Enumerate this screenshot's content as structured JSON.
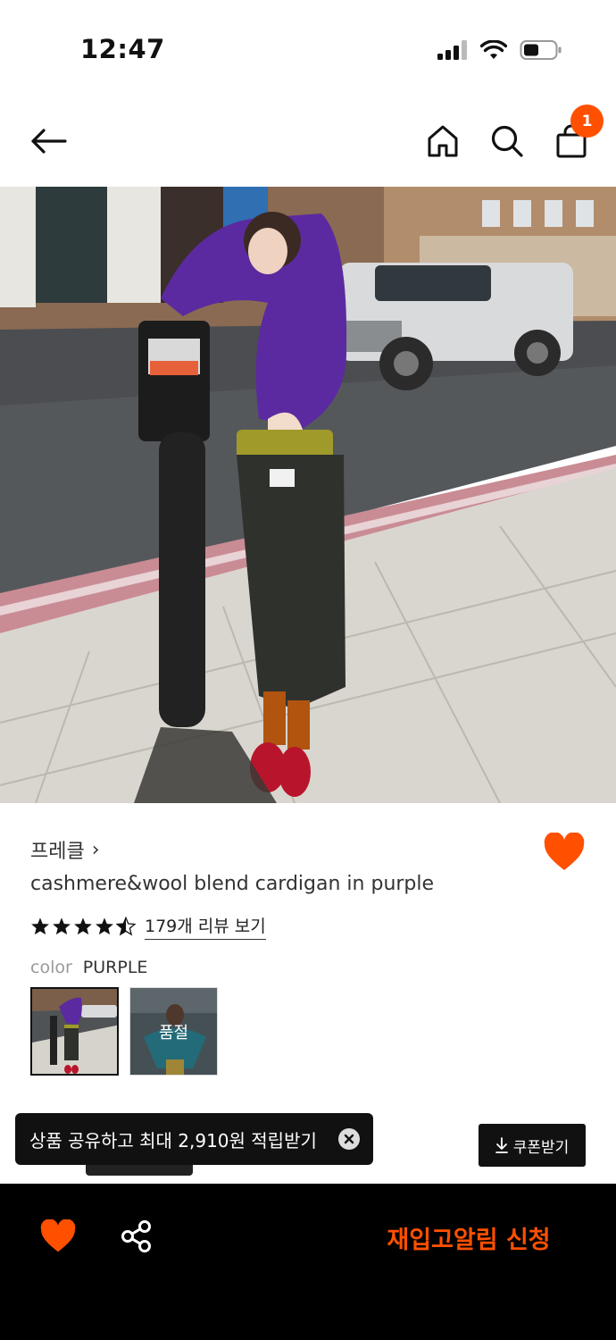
{
  "status_bar": {
    "time": "12:47"
  },
  "nav": {
    "cart_count": "1",
    "icons": [
      "back-arrow-icon",
      "home-icon",
      "search-icon",
      "shopping-bag-icon"
    ]
  },
  "product": {
    "brand": "프레클",
    "brand_chevron": "›",
    "name": "cashmere&wool blend cardigan in purple",
    "rating": 4.5,
    "review_link": "179개 리뷰 보기",
    "color_label": "color",
    "color_value": "PURPLE",
    "swatches": [
      {
        "soldout_label": ""
      },
      {
        "soldout_label": "품절"
      }
    ]
  },
  "toast": {
    "text": "상품 공유하고 최대 2,910원 적립받기"
  },
  "coupon": {
    "label": "쿠폰받기"
  },
  "bottom_bar": {
    "cta": "재입고알림 신청"
  },
  "colors": {
    "accent": "#ff5000",
    "dark": "#111111",
    "bottom_bar": "#000000"
  }
}
